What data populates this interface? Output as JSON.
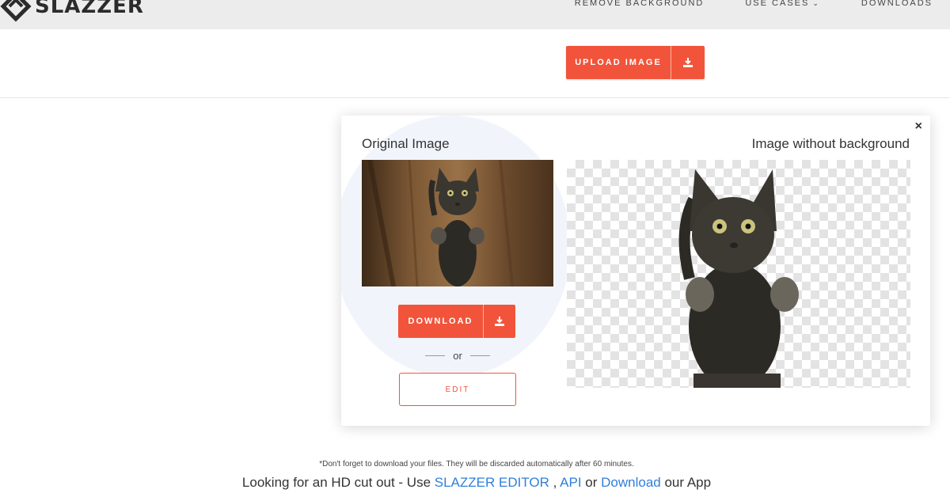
{
  "header": {
    "logo_text": "SLAZZER",
    "nav": [
      {
        "label": "REMOVE BACKGROUND"
      },
      {
        "label": "USE CASES",
        "has_dropdown": true
      },
      {
        "label": "DOWNLOADS"
      }
    ]
  },
  "upload": {
    "label": "UPLOAD IMAGE",
    "icon": "upload-icon"
  },
  "result": {
    "left_title": "Original Image",
    "right_title": "Image without background",
    "close_label": "×",
    "download_label": "DOWNLOAD",
    "or_label": "or",
    "edit_label": "EDIT"
  },
  "footer": {
    "note": "*Don't forget to download your files. They will be discarded automatically after 60 minutes.",
    "hd_prefix": "Looking for an HD cut out - Use ",
    "hd_link1": "SLAZZER EDITOR",
    "hd_sep1": " , ",
    "hd_link2": "API",
    "hd_mid": " or ",
    "hd_link3": "Download",
    "hd_suffix": " our App"
  },
  "colors": {
    "accent": "#f1543a",
    "link": "#2f7fdb"
  }
}
